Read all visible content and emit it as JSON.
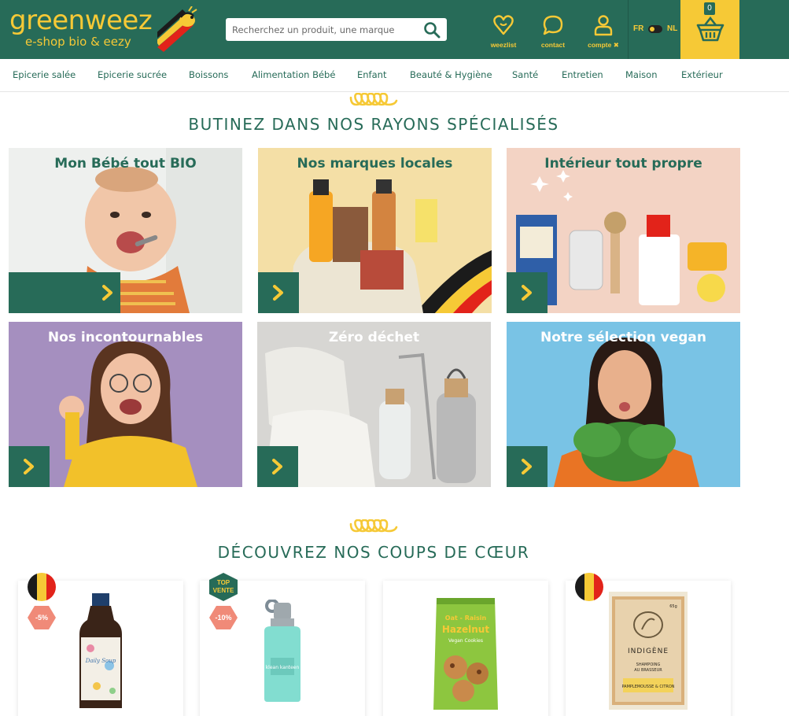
{
  "header": {
    "logo_word": "greenweez",
    "logo_tagline": "e-shop bio & eezy",
    "search_placeholder": "Recherchez un produit, une marque",
    "icons": [
      {
        "label": "weezlist",
        "icon": "heart-icon"
      },
      {
        "label": "contact",
        "icon": "chat-bubble-icon"
      },
      {
        "label": "compte ✖",
        "icon": "user-icon"
      }
    ],
    "lang_fr": "FR",
    "lang_nl": "NL",
    "cart_count": "0",
    "colors": {
      "primary": "#276b58",
      "accent": "#f6c936"
    }
  },
  "nav": [
    "Epicerie salée",
    "Epicerie sucrée",
    "Boissons",
    "Alimentation Bébé",
    "Enfant",
    "Beauté & Hygiène",
    "Santé",
    "Entretien",
    "Maison",
    "Extérieur"
  ],
  "section1_title": "BUTINEZ DANS NOS RAYONS SPÉCIALISÉS",
  "tiles": [
    {
      "title": "Mon Bébé tout BIO"
    },
    {
      "title": "Nos marques locales"
    },
    {
      "title": "Intérieur tout propre"
    },
    {
      "title": "Nos incontournables"
    },
    {
      "title": "Zéro déchet"
    },
    {
      "title": "Notre sélection vegan"
    }
  ],
  "section2_title": "DÉCOUVREZ NOS COUPS DE CŒUR",
  "products": [
    {
      "flag": "belgium-flag-icon",
      "discount": "-5%",
      "top_label": ""
    },
    {
      "flag": "",
      "discount": "-10%",
      "top_label": "TOP VENTE"
    },
    {
      "flag": "",
      "discount": "",
      "top_label": ""
    },
    {
      "flag": "belgium-flag-icon",
      "discount": "",
      "top_label": ""
    }
  ],
  "product_texts": {
    "kombucha_label": "Daily Soup",
    "bottle_brand": "klean kanteen",
    "cookie_line1": "Oat - Raisin",
    "cookie_line2": "Hazelnut",
    "cookie_line3": "Vegan Cookies",
    "soap_brand": "INDIGÈNE",
    "soap_line1": "SHAMPOING",
    "soap_line2": "AU BRASSEUR",
    "soap_scent": "PAMPLEMOUSSE & CITRON",
    "soap_weight": "65g"
  }
}
